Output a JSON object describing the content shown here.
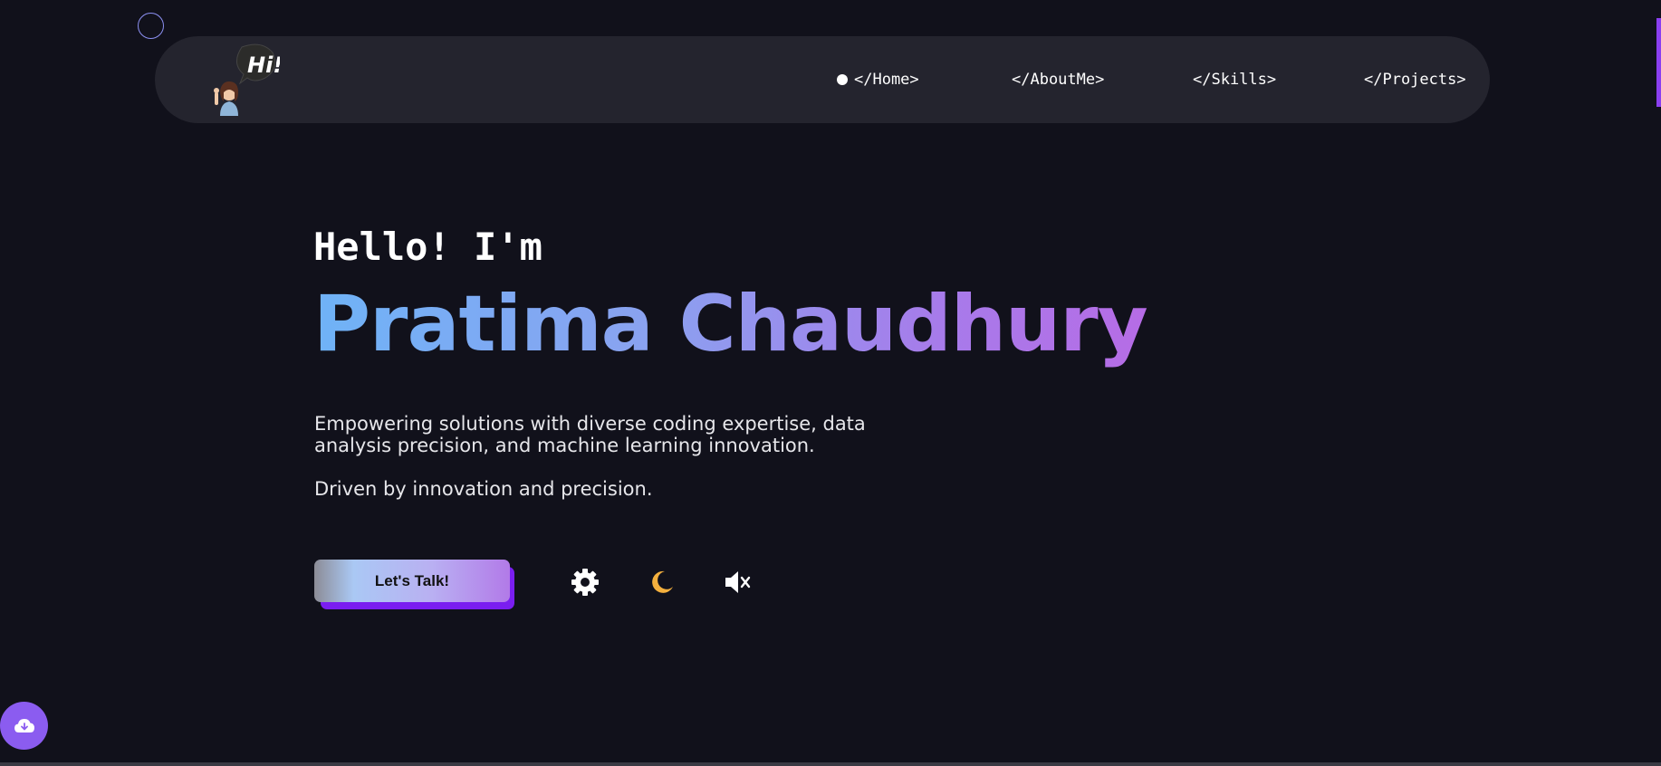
{
  "nav": {
    "logo_text": "Hi!",
    "items": [
      {
        "label": "</Home>",
        "active": true
      },
      {
        "label": "</AboutMe>",
        "active": false
      },
      {
        "label": "</Skills>",
        "active": false
      },
      {
        "label": "</Projects>",
        "active": false
      }
    ]
  },
  "hero": {
    "greeting": "Hello! I'm",
    "name": "Pratima Chaudhury",
    "description": "Empowering solutions with diverse coding expertise, data analysis precision, and machine learning innovation.",
    "tagline": "Driven by innovation and precision.",
    "cta_label": "Let's Talk!"
  },
  "controls": {
    "settings_icon": "gear-icon",
    "theme_icon": "moon-icon",
    "sound_icon": "speaker-muted-icon"
  },
  "fab": {
    "icon": "cloud-download-icon"
  },
  "colors": {
    "background": "#11111b",
    "navbar": "#24242e",
    "accent_purple": "#8b5cf0",
    "name_gradient_start": "#6fb3f7",
    "name_gradient_end": "#b66ce6",
    "moon": "#f4b03e"
  }
}
